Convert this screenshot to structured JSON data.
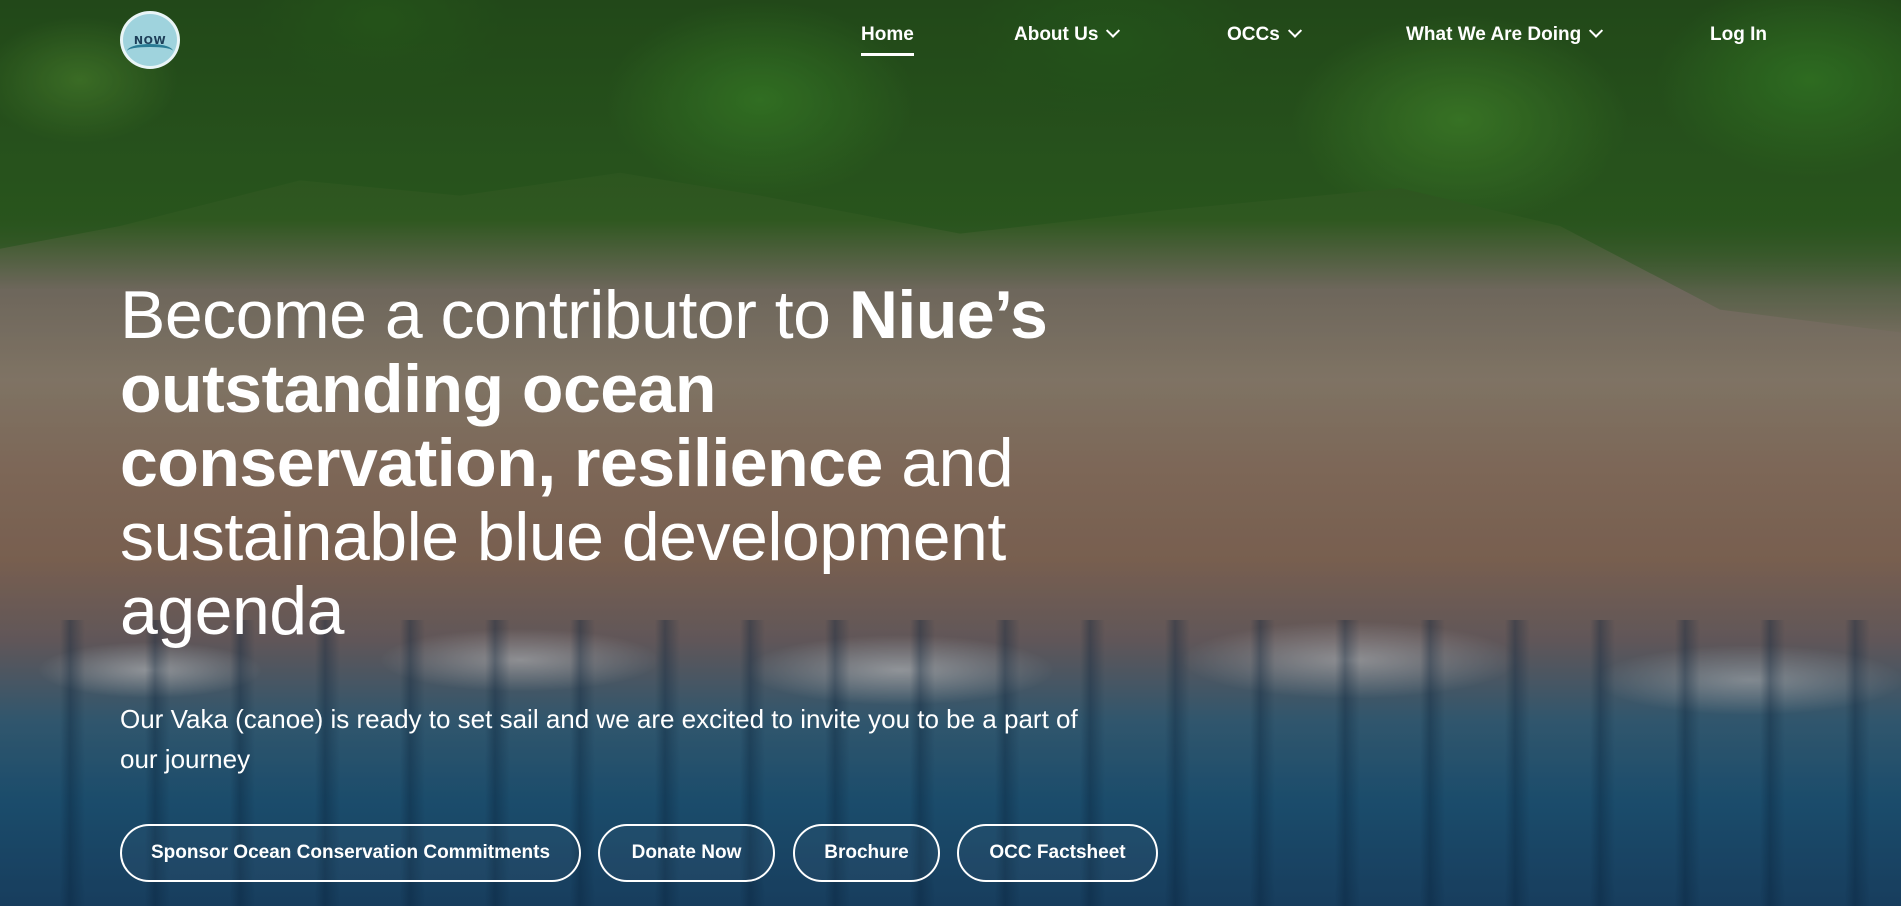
{
  "logo": {
    "text": "NOW"
  },
  "nav": {
    "home": "Home",
    "about": "About Us",
    "occs": "OCCs",
    "doing": "What We Are Doing",
    "login": "Log In"
  },
  "hero": {
    "headline_part1": "Become a contributor to ",
    "headline_bold": "Niue’s outstanding ocean conservation, resilience",
    "headline_part2": " and sustainable blue development agenda",
    "subtext": "Our Vaka (canoe) is ready to set sail and we are excited to invite you to be a part of our journey"
  },
  "buttons": {
    "sponsor": "Sponsor Ocean Conservation Commitments",
    "donate": "Donate Now",
    "brochure": "Brochure",
    "factsheet": "OCC Factsheet"
  }
}
